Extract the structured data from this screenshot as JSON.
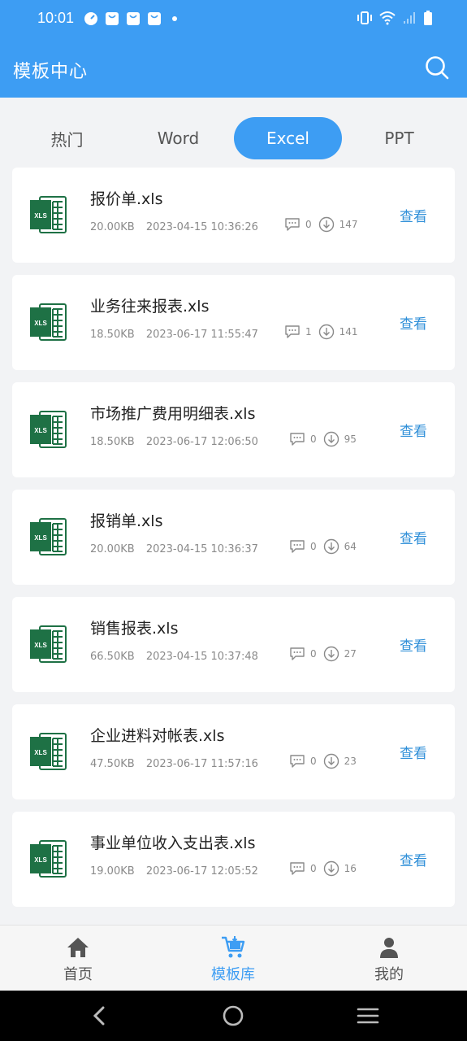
{
  "status_bar": {
    "time": "10:01"
  },
  "header": {
    "title": "模板中心",
    "search_icon": "search-icon"
  },
  "tabs": [
    {
      "label": "热门",
      "active": false
    },
    {
      "label": "Word",
      "active": false
    },
    {
      "label": "Excel",
      "active": true
    },
    {
      "label": "PPT",
      "active": false
    }
  ],
  "files": [
    {
      "name": "报价单.xls",
      "size": "20.00KB",
      "date": "2023-04-15 10:36:26",
      "comments": "0",
      "downloads": "147",
      "action": "查看"
    },
    {
      "name": "业务往来报表.xls",
      "size": "18.50KB",
      "date": "2023-06-17 11:55:47",
      "comments": "1",
      "downloads": "141",
      "action": "查看"
    },
    {
      "name": "市场推广费用明细表.xls",
      "size": "18.50KB",
      "date": "2023-06-17 12:06:50",
      "comments": "0",
      "downloads": "95",
      "action": "查看"
    },
    {
      "name": "报销单.xls",
      "size": "20.00KB",
      "date": "2023-04-15 10:36:37",
      "comments": "0",
      "downloads": "64",
      "action": "查看"
    },
    {
      "name": "销售报表.xls",
      "size": "66.50KB",
      "date": "2023-04-15 10:37:48",
      "comments": "0",
      "downloads": "27",
      "action": "查看"
    },
    {
      "name": "企业进料对帐表.xls",
      "size": "47.50KB",
      "date": "2023-06-17 11:57:16",
      "comments": "0",
      "downloads": "23",
      "action": "查看"
    },
    {
      "name": "事业单位收入支出表.xls",
      "size": "19.00KB",
      "date": "2023-06-17 12:05:52",
      "comments": "0",
      "downloads": "16",
      "action": "查看"
    }
  ],
  "bottom_nav": [
    {
      "label": "首页",
      "icon": "home-icon",
      "active": false
    },
    {
      "label": "模板库",
      "icon": "cart-icon",
      "active": true
    },
    {
      "label": "我的",
      "icon": "user-icon",
      "active": false
    }
  ],
  "colors": {
    "brand": "#3d9df3",
    "link": "#2f8fd8",
    "excel_green": "#1e7145"
  },
  "file_icon_label": "XLS"
}
